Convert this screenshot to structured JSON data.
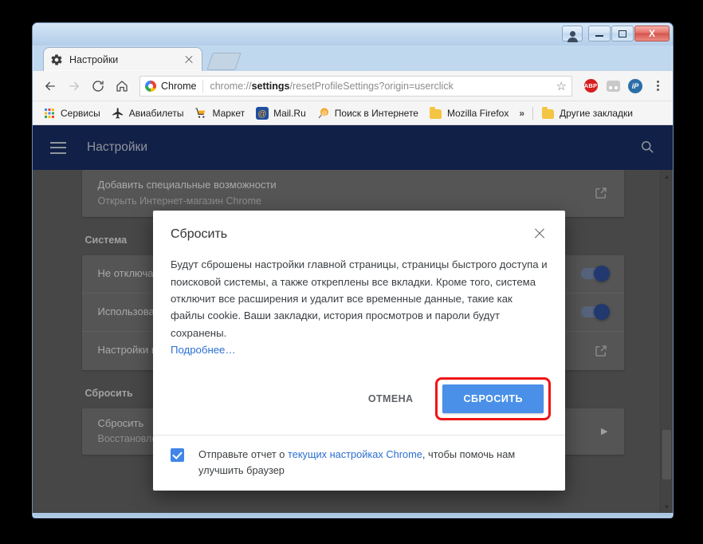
{
  "window": {
    "buttons": {
      "user": "user-avatar",
      "minimize": "—",
      "maximize": "❐",
      "close": "X"
    }
  },
  "tab": {
    "title": "Настройки",
    "favicon": "gear-icon",
    "close_label": "×"
  },
  "toolbar": {
    "back": "←",
    "forward": "→",
    "reload": "C",
    "home": "⌂",
    "chrome_badge": "Chrome",
    "url_prefix": "chrome://",
    "url_bold": "settings",
    "url_suffix": "/resetProfileSettings?origin=userclick",
    "url_full": "chrome://settings/resetProfileSettings?origin=userclick",
    "star": "☆",
    "extensions": [
      {
        "name": "adblock-plus",
        "label": "ABP"
      },
      {
        "name": "generic-extension",
        "label": ""
      },
      {
        "name": "ip-extension",
        "label": "iP"
      }
    ],
    "menu": "⋮"
  },
  "bookmarks": {
    "items": [
      {
        "label": "Сервисы",
        "icon": "apps-grid-icon"
      },
      {
        "label": "Авиабилеты",
        "icon": "airplane-icon"
      },
      {
        "label": "Маркет",
        "icon": "shopping-cart-icon"
      },
      {
        "label": "Mail.Ru",
        "icon": "mailru-icon"
      },
      {
        "label": "Поиск в Интернете",
        "icon": "search-at-icon"
      },
      {
        "label": "Mozilla Firefox",
        "icon": "folder-icon"
      }
    ],
    "overflow": "»",
    "other": {
      "label": "Другие закладки",
      "icon": "folder-icon"
    }
  },
  "settings_page": {
    "header_title": "Настройки",
    "hamburger": "menu-icon",
    "search": "search-icon",
    "rows_top": [
      {
        "title": "Добавить специальные возможности",
        "sub": "Открыть Интернет-магазин Chrome",
        "control": "external-link"
      }
    ],
    "section_system": "Система",
    "rows_system": [
      {
        "title": "Не отключать работающие в фоновом режиме сервисы при закрытии браузера",
        "control": "toggle",
        "toggle_on": true
      },
      {
        "title": "Использовать аппаратное ускорение (при наличии)",
        "control": "toggle",
        "toggle_on": true
      },
      {
        "title": "Настройки прокси-сервера",
        "control": "external-link"
      }
    ],
    "section_reset": "Сбросить",
    "rows_reset": [
      {
        "title": "Сбросить",
        "sub": "Восстановление настроек по умолчанию",
        "control": "chevron-right"
      }
    ],
    "scroll_up": "▲",
    "scroll_down": "▼"
  },
  "dialog": {
    "title": "Сбросить",
    "close": "close-icon",
    "body": "Будут сброшены настройки главной страницы, страницы быстрого доступа и поисковой системы, а также откреплены все вкладки. Кроме того, система отключит все расширения и удалит все временные данные, такие как файлы cookie. Ваши закладки, история просмотров и пароли будут сохранены.",
    "more_link": "Подробнее…",
    "cancel_label": "ОТМЕНА",
    "reset_label": "СБРОСИТЬ",
    "footer_pre": "Отправьте отчет о ",
    "footer_link": "текущих настройках Chrome",
    "footer_post": ", чтобы помочь нам улучшить браузер",
    "checkbox_checked": true
  },
  "annotation": {
    "highlight_color": "#f01414",
    "target": "СБРОСИТЬ"
  },
  "colors": {
    "settings_header": "#16295c",
    "primary_button": "#4a90e8",
    "link": "#2a6fd0",
    "page_bg": "#5b5b5b"
  }
}
